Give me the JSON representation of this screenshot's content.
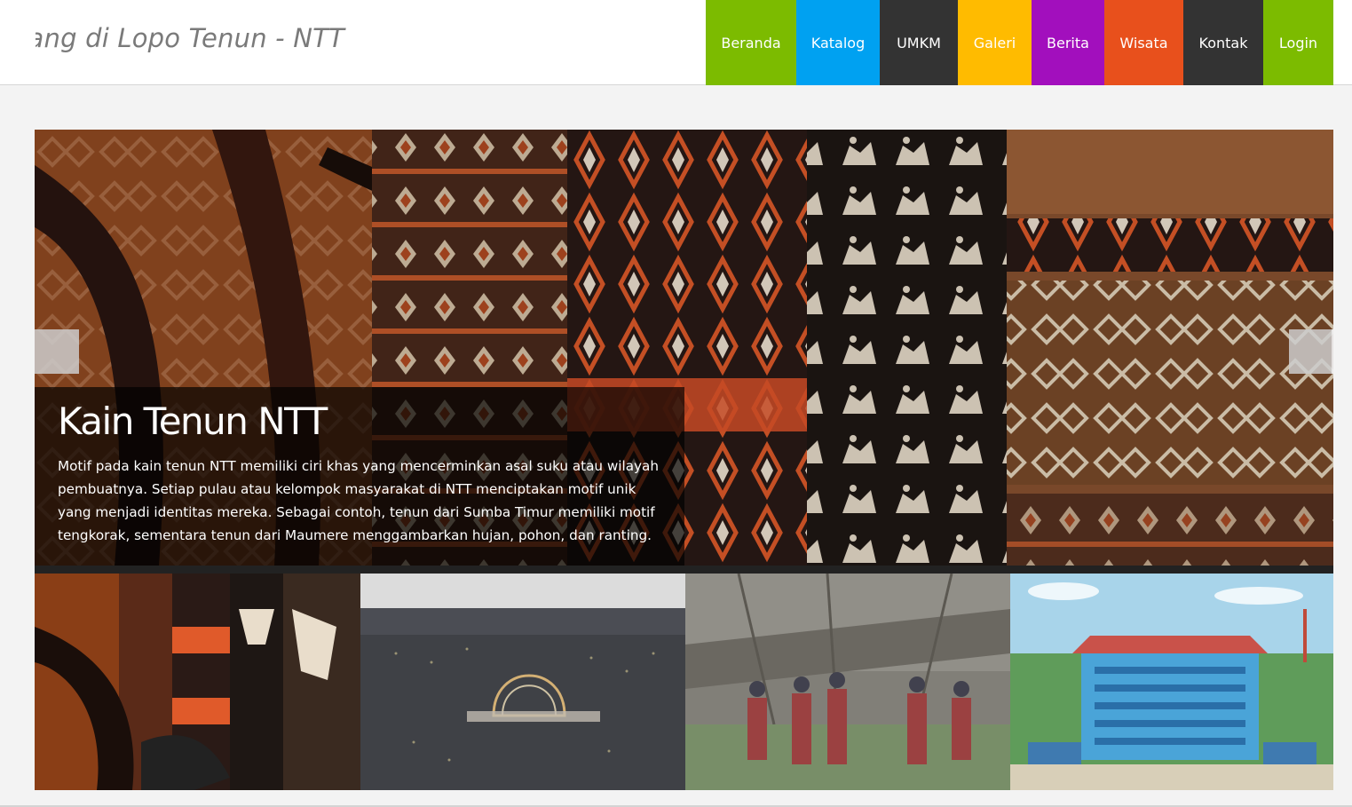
{
  "site": {
    "title": "atang di Lopo Tenun - NTT"
  },
  "nav": {
    "items": [
      {
        "label": "Beranda",
        "color": "#7cbb00"
      },
      {
        "label": "Katalog",
        "color": "#00a1f1"
      },
      {
        "label": "UMKM",
        "color": "#333333"
      },
      {
        "label": "Galeri",
        "color": "#ffbb00"
      },
      {
        "label": "Berita",
        "color": "#a20fbd"
      },
      {
        "label": "Wisata",
        "color": "#f25022"
      },
      {
        "label": "Kontak",
        "color": "#333333"
      },
      {
        "label": "Login",
        "color": "#7cbb00"
      }
    ]
  },
  "slider": {
    "caption_title": "Kain Tenun NTT",
    "caption_text": "Motif pada kain tenun NTT memiliki ciri khas yang mencerminkan asal suku atau wilayah pembuatnya. Setiap pulau atau kelompok masyarakat di NTT menciptakan motif unik yang menjadi identitas mereka. Sebagai contoh, tenun dari Sumba Timur memiliki motif tengkorak, sementara tenun dari Maumere menggambarkan hujan, pohon, dan ranting."
  },
  "thumbnails": [
    {
      "subject": "woven-textiles"
    },
    {
      "subject": "night-city-aerial"
    },
    {
      "subject": "traditional-dance"
    },
    {
      "subject": "government-building"
    }
  ]
}
